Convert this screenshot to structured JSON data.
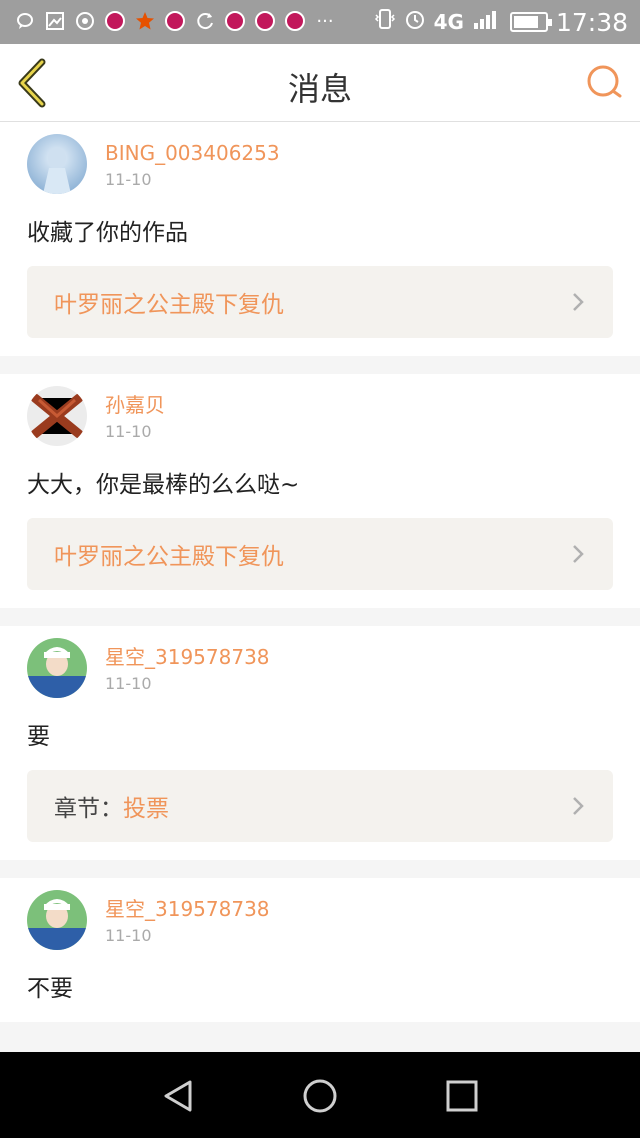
{
  "status_bar": {
    "network": "4G",
    "time": "17:38"
  },
  "header": {
    "title": "消息",
    "back_icon": "chevron-left-icon",
    "search_icon": "search-icon"
  },
  "messages": [
    {
      "username": "BING_003406253",
      "date": "11-10",
      "text": "收藏了你的作品",
      "link_label": "",
      "link_value": "叶罗丽之公主殿下复仇"
    },
    {
      "username": "孙嘉贝",
      "date": "11-10",
      "text": "大大，你是最棒的么么哒~",
      "link_label": "",
      "link_value": "叶罗丽之公主殿下复仇"
    },
    {
      "username": "星空_319578738",
      "date": "11-10",
      "text": "要",
      "link_label": "章节：",
      "link_value": "投票"
    },
    {
      "username": "星空_319578738",
      "date": "11-10",
      "text": "不要",
      "link_label": "",
      "link_value": ""
    }
  ],
  "colors": {
    "accent": "#f0955a",
    "status_bar": "#9e9e9e",
    "link_box": "#f4f2ee"
  }
}
